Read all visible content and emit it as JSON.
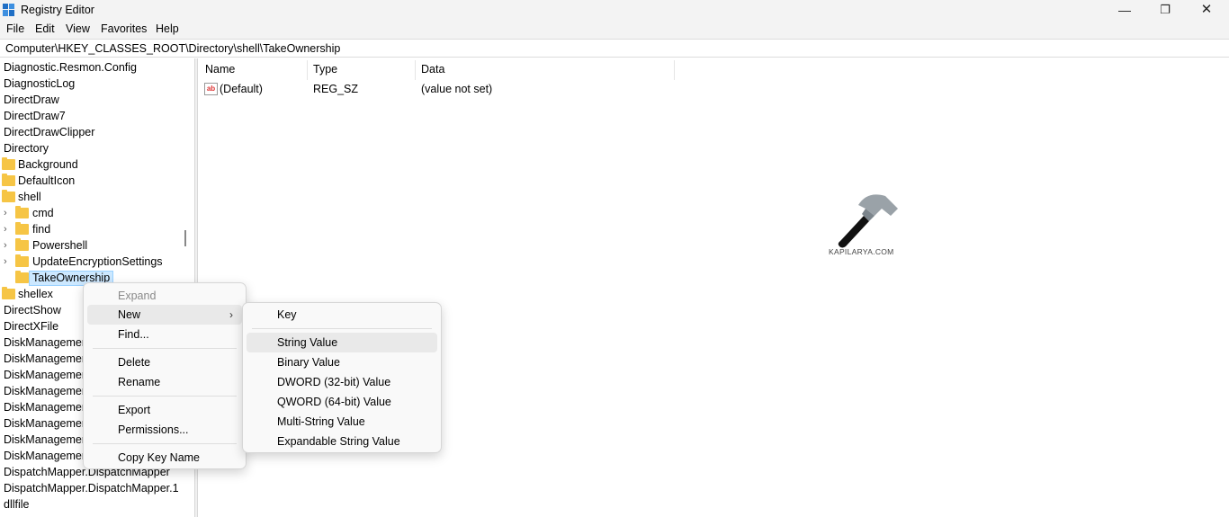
{
  "window": {
    "title": "Registry Editor",
    "minimize": "—",
    "maximize": "❐",
    "close": "✕"
  },
  "menubar": {
    "items": [
      "File",
      "Edit",
      "View",
      "Favorites",
      "Help"
    ]
  },
  "address": {
    "path": "Computer\\HKEY_CLASSES_ROOT\\Directory\\shell\\TakeOwnership"
  },
  "tree": {
    "items": [
      {
        "label": "Diagnostic.Resmon.Config"
      },
      {
        "label": "DiagnosticLog"
      },
      {
        "label": "DirectDraw"
      },
      {
        "label": "DirectDraw7"
      },
      {
        "label": "DirectDrawClipper"
      },
      {
        "label": "Directory"
      },
      {
        "label": "Background"
      },
      {
        "label": "DefaultIcon"
      },
      {
        "label": "shell"
      },
      {
        "label": "cmd"
      },
      {
        "label": "find"
      },
      {
        "label": "Powershell"
      },
      {
        "label": "UpdateEncryptionSettings"
      },
      {
        "label": "TakeOwnership"
      },
      {
        "label": "shellex"
      },
      {
        "label": "DirectShow"
      },
      {
        "label": "DirectXFile"
      },
      {
        "label": "DiskManagemen"
      },
      {
        "label": "DiskManagemen"
      },
      {
        "label": "DiskManagemen"
      },
      {
        "label": "DiskManagemen"
      },
      {
        "label": "DiskManagemen"
      },
      {
        "label": "DiskManagemen"
      },
      {
        "label": "DiskManagemen"
      },
      {
        "label": "DiskManagemen"
      },
      {
        "label": "DispatchMapper.DispatchMapper"
      },
      {
        "label": "DispatchMapper.DispatchMapper.1"
      },
      {
        "label": "dllfile"
      }
    ]
  },
  "list": {
    "columns": [
      "Name",
      "Type",
      "Data"
    ],
    "rows": [
      {
        "name": "(Default)",
        "type": "REG_SZ",
        "data": "(value not set)",
        "icon": "string-value-icon"
      }
    ]
  },
  "watermark": {
    "text": "KAPILARYA.COM",
    "icon": "hammer-icon"
  },
  "context_menu": {
    "items": [
      {
        "label": "Expand",
        "disabled": true
      },
      {
        "label": "New",
        "submenu": true
      },
      {
        "label": "Find..."
      },
      {
        "label": "Delete"
      },
      {
        "label": "Rename"
      },
      {
        "label": "Export"
      },
      {
        "label": "Permissions..."
      },
      {
        "label": "Copy Key Name"
      }
    ],
    "arrow": "›"
  },
  "submenu": {
    "items": [
      {
        "label": "Key"
      },
      {
        "label": "String Value",
        "highlighted": true
      },
      {
        "label": "Binary Value"
      },
      {
        "label": "DWORD (32-bit) Value"
      },
      {
        "label": "QWORD (64-bit) Value"
      },
      {
        "label": "Multi-String Value"
      },
      {
        "label": "Expandable String Value"
      }
    ]
  },
  "colors": {
    "folder": "#f6c545",
    "selection": "#cce8ff",
    "chrome": "#f3f3f3"
  }
}
